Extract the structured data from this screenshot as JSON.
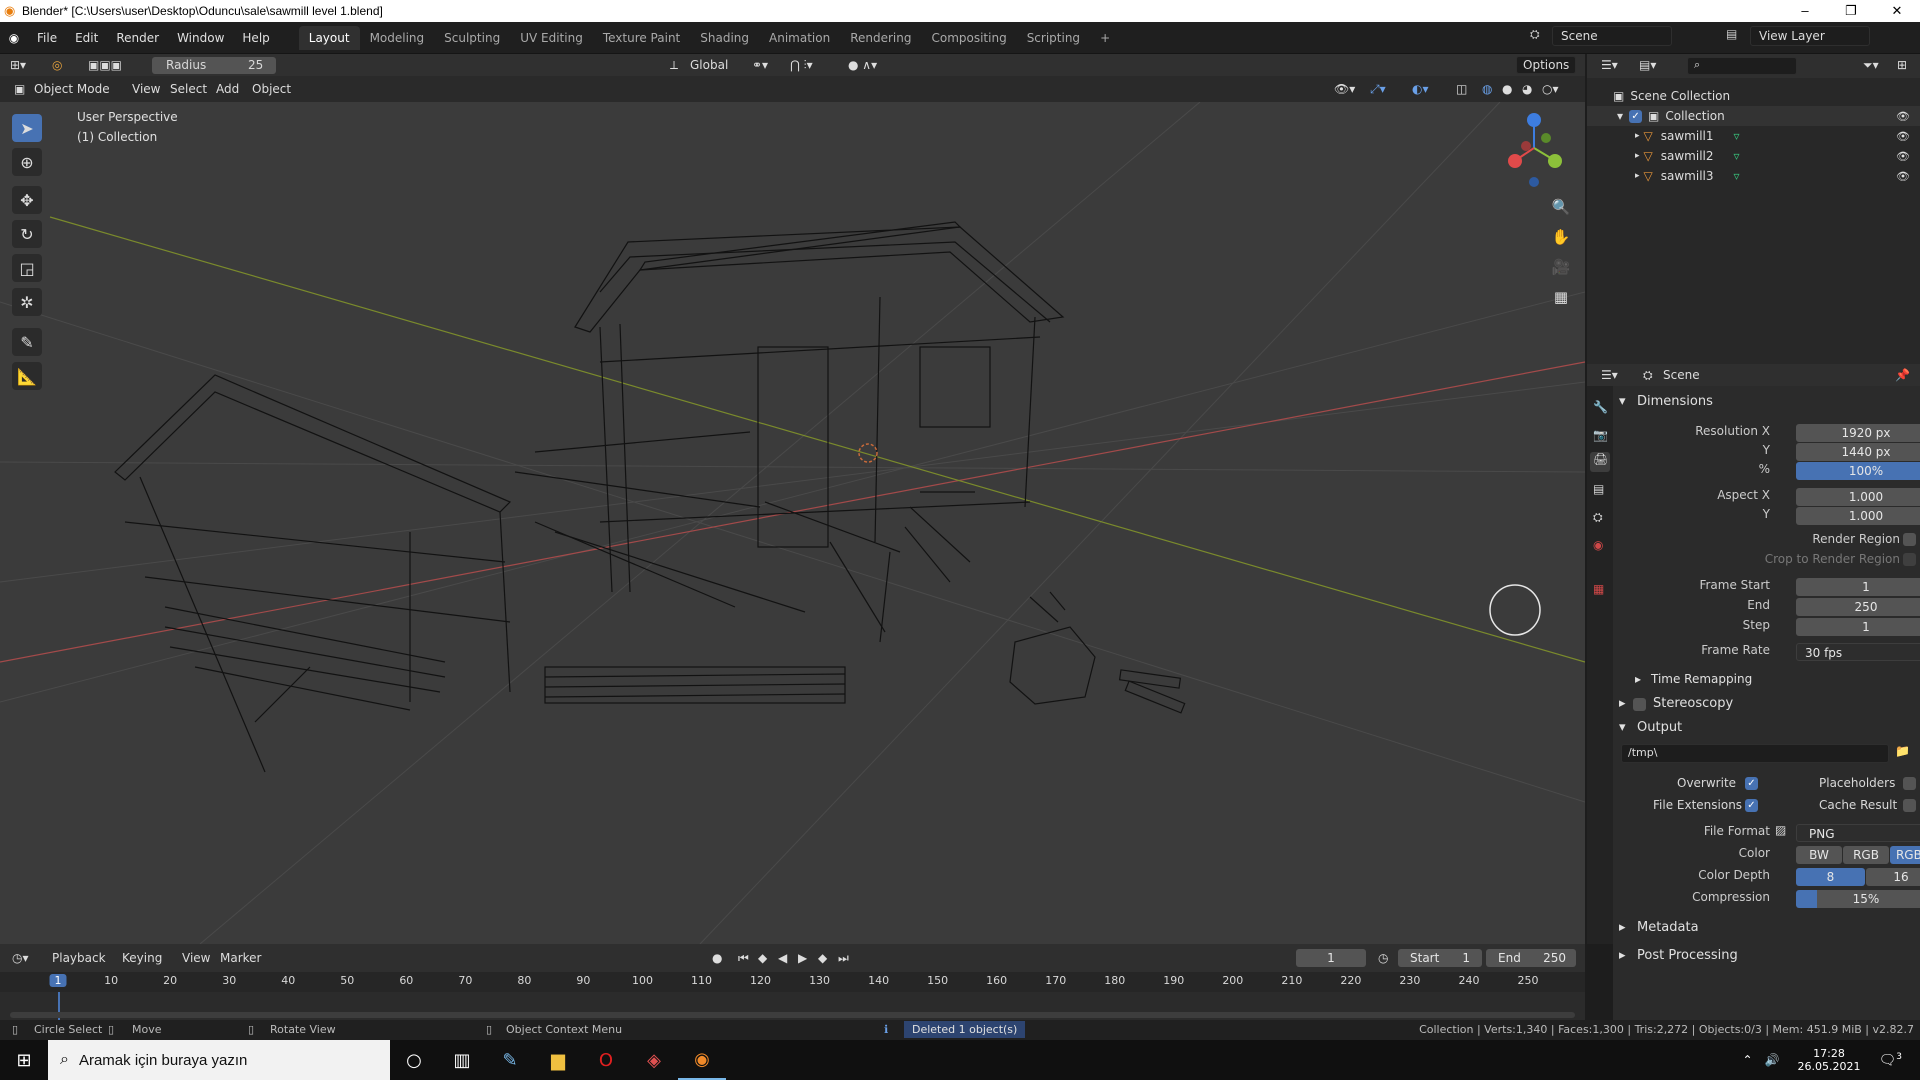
{
  "window": {
    "title": "Blender* [C:\\Users\\user\\Desktop\\Oduncu\\sale\\sawmill level 1.blend]"
  },
  "menus": [
    "File",
    "Edit",
    "Render",
    "Window",
    "Help"
  ],
  "workspace_tabs": [
    "Layout",
    "Modeling",
    "Sculpting",
    "UV Editing",
    "Texture Paint",
    "Shading",
    "Animation",
    "Rendering",
    "Compositing",
    "Scripting"
  ],
  "active_tab": "Layout",
  "scene": {
    "name": "Scene",
    "view_layer": "View Layer"
  },
  "tool_header": {
    "radius_label": "Radius",
    "radius_value": "25",
    "orientation": "Global",
    "options": "Options"
  },
  "viewport_header": {
    "mode": "Object Mode",
    "menus": [
      "View",
      "Select",
      "Add",
      "Object"
    ]
  },
  "viewport": {
    "perspective": "User Perspective",
    "collection": "(1) Collection"
  },
  "outliner": {
    "root": "Scene Collection",
    "collection": "Collection",
    "objects": [
      "sawmill1",
      "sawmill2",
      "sawmill3"
    ]
  },
  "properties": {
    "context": "Scene",
    "dimensions": {
      "title": "Dimensions",
      "res_x_label": "Resolution X",
      "res_x": "1920 px",
      "res_y_label": "Y",
      "res_y": "1440 px",
      "pct_label": "%",
      "pct": "100%",
      "asp_x_label": "Aspect X",
      "asp_x": "1.000",
      "asp_y_label": "Y",
      "asp_y": "1.000",
      "render_region": "Render Region",
      "crop": "Crop to Render Region",
      "frame_start_label": "Frame Start",
      "frame_start": "1",
      "end_label": "End",
      "end": "250",
      "step_label": "Step",
      "step": "1",
      "frame_rate_label": "Frame Rate",
      "frame_rate": "30 fps",
      "time_remap": "Time Remapping"
    },
    "stereoscopy": "Stereoscopy",
    "output": {
      "title": "Output",
      "path": "/tmp\\",
      "overwrite": "Overwrite",
      "placeholders": "Placeholders",
      "file_ext": "File Extensions",
      "cache": "Cache Result",
      "format_label": "File Format",
      "format": "PNG",
      "color_label": "Color",
      "color_opts": [
        "BW",
        "RGB",
        "RGBA"
      ],
      "depth_label": "Color Depth",
      "depth_opts": [
        "8",
        "16"
      ],
      "comp_label": "Compression",
      "comp": "15%"
    },
    "metadata": "Metadata",
    "post": "Post Processing"
  },
  "timeline": {
    "menus": [
      "Playback",
      "Keying",
      "View",
      "Marker"
    ],
    "current": "1",
    "start_label": "Start",
    "start": "1",
    "end_label": "End",
    "end": "250",
    "ticks": [
      "1",
      "10",
      "20",
      "30",
      "40",
      "50",
      "60",
      "70",
      "80",
      "90",
      "100",
      "110",
      "120",
      "130",
      "140",
      "150",
      "160",
      "170",
      "180",
      "190",
      "200",
      "210",
      "220",
      "230",
      "240",
      "250"
    ]
  },
  "statusbar": {
    "circle": "Circle Select",
    "move": "Move",
    "rotate": "Rotate View",
    "ctx": "Object Context Menu",
    "msg": "Deleted 1 object(s)",
    "stats": "Collection | Verts:1,340 | Faces:1,300 | Tris:2,272 | Objects:0/3 | Mem: 451.9 MiB | v2.82.7"
  },
  "taskbar": {
    "search": "Aramak için buraya yazın",
    "time": "17:28",
    "date": "26.05.2021",
    "notif": "3"
  }
}
